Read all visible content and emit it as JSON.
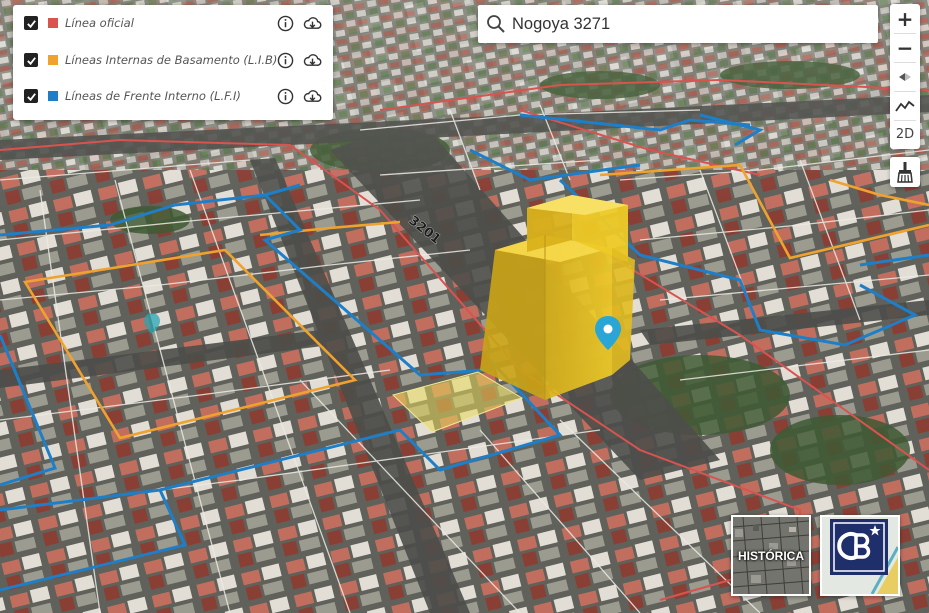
{
  "layers": [
    {
      "label": "Línea oficial",
      "color": "#d9534f",
      "checked": true
    },
    {
      "label": "Líneas Internas de Basamento (L.I.B)",
      "color": "#f0a22e",
      "checked": true
    },
    {
      "label": "Líneas de Frente Interno (L.F.I)",
      "color": "#1e7fc8",
      "checked": true
    }
  ],
  "search": {
    "value": "Nogoya 3271"
  },
  "controls": {
    "zoom_in": "+",
    "zoom_out": "−",
    "mode_2d": "2D"
  },
  "street_label": "3201",
  "thumbnails": {
    "historica_label": "HISTÓRICA"
  },
  "colors": {
    "linea_oficial": "#d9534f",
    "lib": "#f0a22e",
    "lfi": "#1e7fc8",
    "building": "#e8c21c",
    "marker": "#2aa6d6"
  }
}
